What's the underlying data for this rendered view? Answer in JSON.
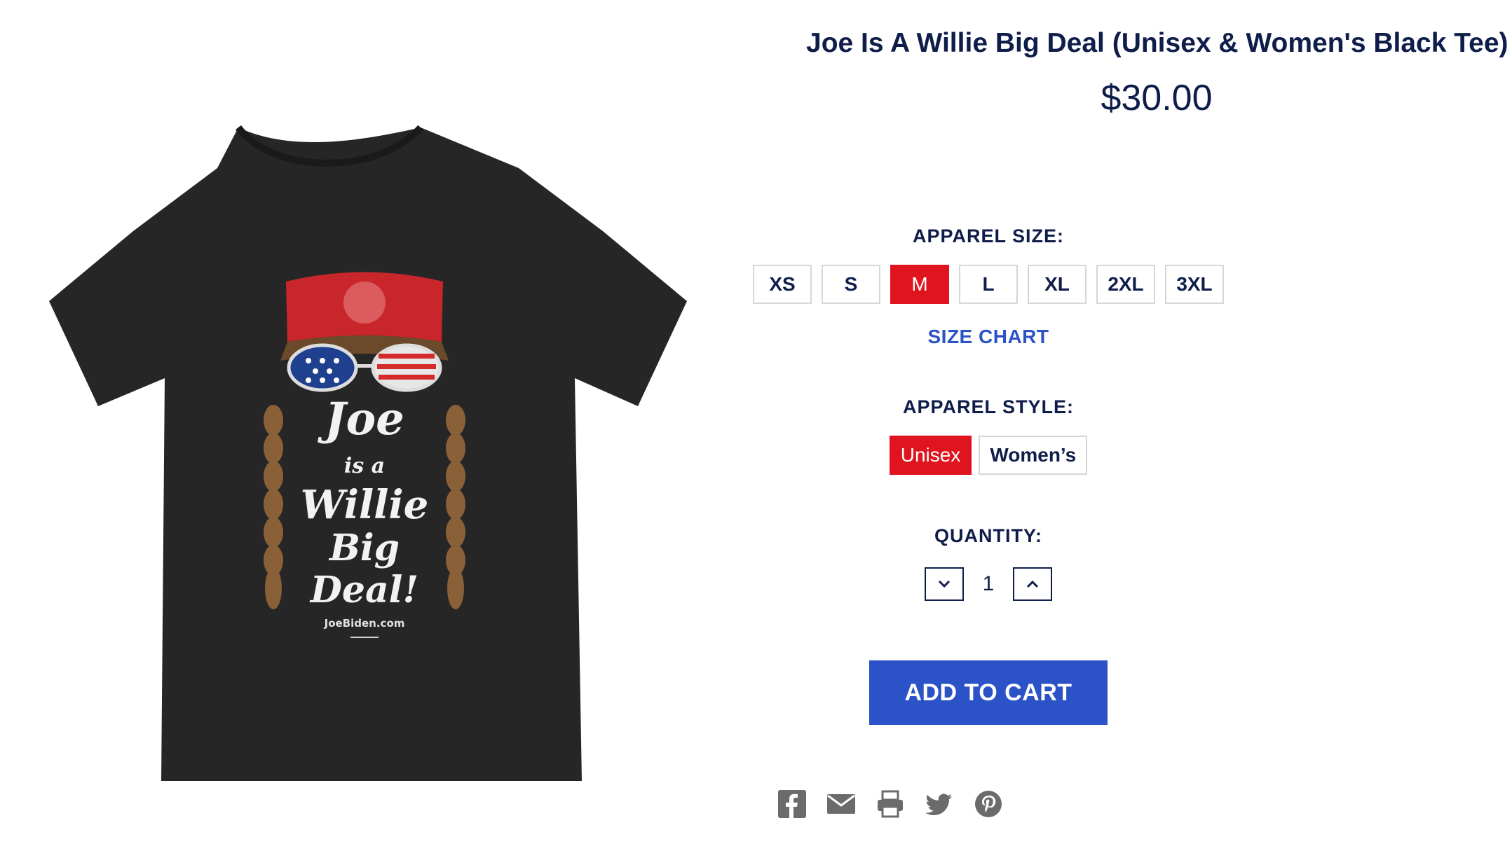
{
  "product": {
    "title": "Joe Is A Willie Big Deal (Unisex & Women's Black Tee)",
    "price": "$30.00",
    "shirt_print": {
      "line1": "Joe",
      "line2": "is a",
      "line3": "Willie",
      "line4": "Big",
      "line5": "Deal!",
      "url": "JoeBiden.com"
    }
  },
  "apparel_size": {
    "label": "APPAREL SIZE:",
    "options": [
      "XS",
      "S",
      "M",
      "L",
      "XL",
      "2XL",
      "3XL"
    ],
    "selected": "M",
    "size_chart_link": "SIZE CHART"
  },
  "apparel_style": {
    "label": "APPAREL STYLE:",
    "options": [
      "Unisex",
      "Women’s"
    ],
    "selected": "Unisex"
  },
  "quantity": {
    "label": "QUANTITY:",
    "value": "1"
  },
  "cart": {
    "button_label": "ADD TO CART"
  },
  "share_icons": [
    "facebook-icon",
    "email-icon",
    "print-icon",
    "twitter-icon",
    "pinterest-icon"
  ],
  "colors": {
    "navy": "#0f1d4a",
    "accent_red": "#e0141e",
    "accent_blue": "#2b52c6",
    "border_gray": "#d6d6d6",
    "icon_gray": "#6b6b6b",
    "shirt": "#262626"
  }
}
